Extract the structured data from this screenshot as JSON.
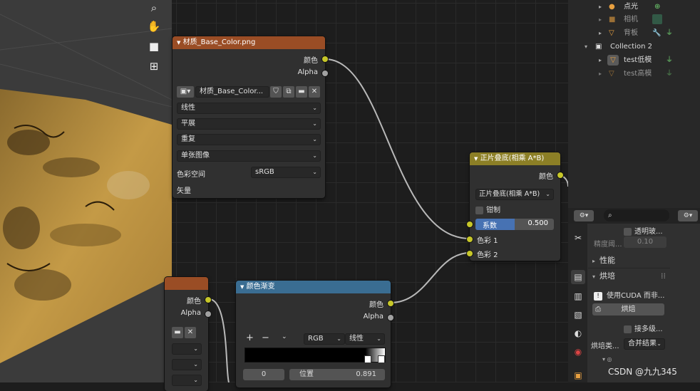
{
  "viewport_tools": [
    {
      "name": "zoom-icon",
      "glyph": "🔍"
    },
    {
      "name": "hand-icon",
      "glyph": "✋"
    },
    {
      "name": "camera-icon",
      "glyph": "🎥"
    },
    {
      "name": "grid-icon",
      "glyph": "⊞"
    }
  ],
  "image_node": {
    "title": "材质_Base_Color.png",
    "out_color": "颜色",
    "out_alpha": "Alpha",
    "image_name": "材质_Base_Color...",
    "interpolation": "线性",
    "projection": "平展",
    "extension": "重复",
    "source": "单张图像",
    "colorspace_label": "色彩空间",
    "colorspace_value": "sRGB",
    "vector_label": "矢量"
  },
  "mix_node": {
    "title": "正片叠底(相乘 A*B)",
    "out_color": "颜色",
    "blend_mode": "正片叠底(相乘 A*B)",
    "clamp_label": "钳制",
    "factor_label": "系数",
    "factor_value": "0.500",
    "factor_fraction": 0.5,
    "in_color1": "色彩 1",
    "in_color2": "色彩 2"
  },
  "ramp_node": {
    "title": "颜色渐变",
    "out_color": "颜色",
    "out_alpha": "Alpha",
    "plus": "+",
    "minus": "−",
    "mode": "RGB",
    "interp": "线性",
    "stop_index": "0",
    "pos_label": "位置",
    "pos_value": "0.891"
  },
  "partial_node": {
    "out_color": "颜色",
    "out_alpha": "Alpha"
  },
  "outliner": {
    "items": [
      {
        "label": "点光",
        "icon": "light-icon"
      },
      {
        "label": "相机",
        "icon": "camera-object-icon"
      },
      {
        "label": "背板",
        "icon": "mesh-icon"
      },
      {
        "label": "Collection 2",
        "icon": "collection-icon"
      },
      {
        "label": "test低模",
        "icon": "mesh-icon"
      },
      {
        "label": "test高模",
        "icon": "mesh-icon"
      }
    ]
  },
  "properties": {
    "transparent_label": "透明玻...",
    "precision_label": "精度阈...",
    "precision_value": "0.10",
    "perf_label": "性能",
    "bake_section": "烘培",
    "cuda_label": "使用CUDA 而非...",
    "bake_button": "烘焙",
    "multires_label": "接多级...",
    "bake_type_label": "烘培类...",
    "bake_type_value": "合并结果",
    "footer_text": "CSDN @九九345"
  },
  "colors": {
    "texture_header": "#9a4d25",
    "mix_header": "#8c7f26",
    "ramp_header": "#3a6d92",
    "socket_color": "#c7c729",
    "factor_fill": "#4772b3"
  }
}
